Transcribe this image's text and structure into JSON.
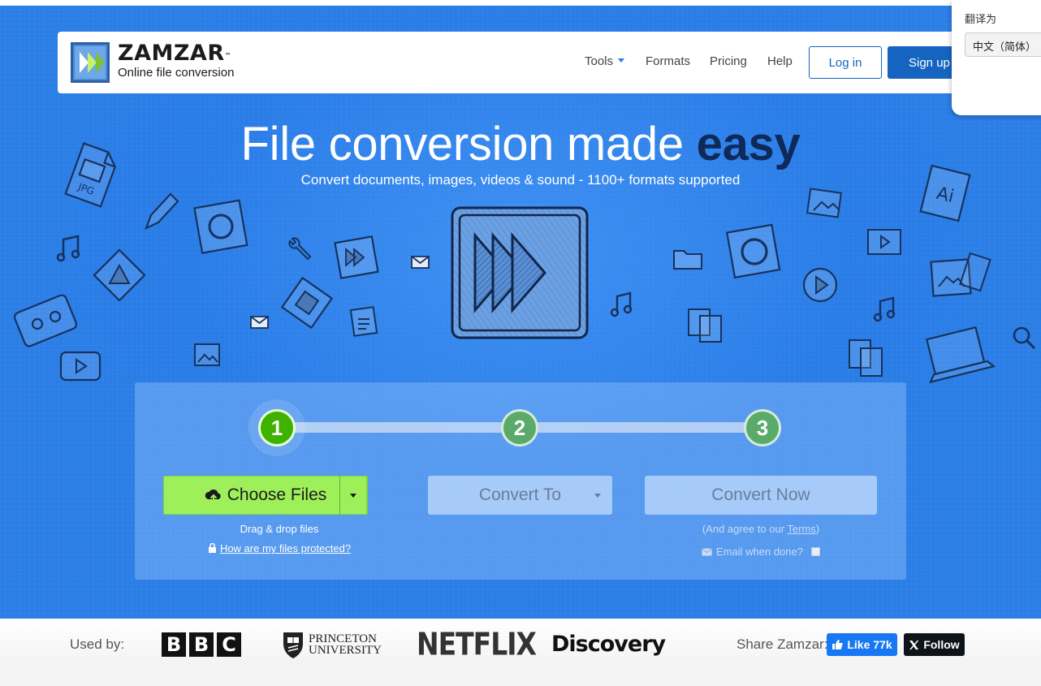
{
  "brand": {
    "name": "ZAMZAR",
    "tm": "™",
    "tagline": "Online file conversion"
  },
  "nav": {
    "tools": "Tools",
    "formats": "Formats",
    "pricing": "Pricing",
    "help": "Help",
    "login": "Log in",
    "signup": "Sign up"
  },
  "translate": {
    "label": "翻译为",
    "selected": "中文（简体）"
  },
  "hero": {
    "headline_main": "File conversion made ",
    "headline_emph": "easy",
    "subhead": "Convert documents, images, videos & sound - 1100+ formats supported"
  },
  "converter": {
    "steps": [
      "1",
      "2",
      "3"
    ],
    "choose_files": "Choose Files",
    "convert_to": "Convert To",
    "convert_now": "Convert Now",
    "drag_drop": "Drag & drop files",
    "protected_link": "How are my files protected?",
    "agree_prefix": "(And agree to our ",
    "terms": "Terms",
    "agree_suffix": ")",
    "email_when_done": "Email when done?"
  },
  "used_by": {
    "label": "Used by:",
    "bbc_letters": [
      "B",
      "B",
      "C"
    ],
    "princeton_line1": "PRINCETON",
    "princeton_line2": "UNIVERSITY",
    "netflix": "NETFLIX",
    "discovery": "Discovery"
  },
  "share": {
    "label": "Share Zamzar:",
    "like": "Like 77k",
    "follow": "Follow"
  },
  "colors": {
    "hero_blue": "#2a7ee6",
    "easy": "#0e2a5b",
    "choose_green": "#9ef05a",
    "step_active": "#3fb100",
    "primary_button": "#1565c0",
    "facebook": "#1877f2",
    "x_black": "#0f1419"
  }
}
